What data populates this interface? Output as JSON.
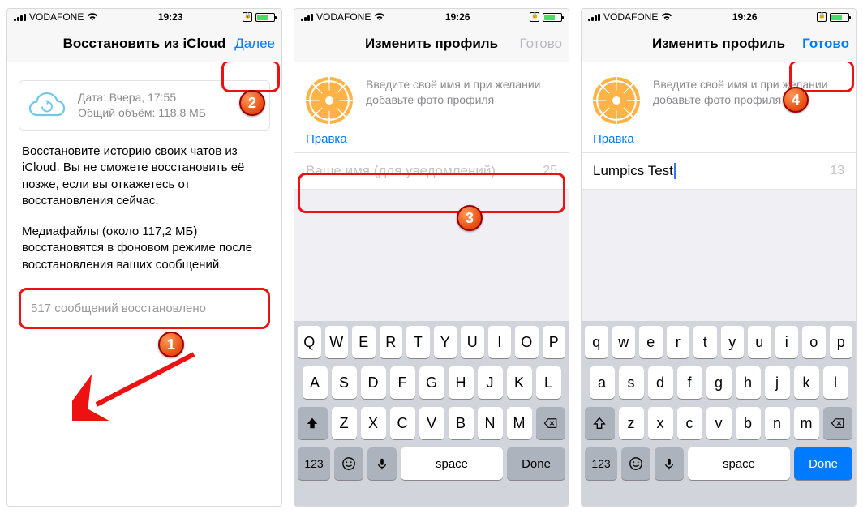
{
  "annotations": {
    "b1": "1",
    "b2": "2",
    "b3": "3",
    "b4": "4"
  },
  "screen1": {
    "carrier": "VODAFONE",
    "time": "19:23",
    "navTitle": "Восстановить из iCloud",
    "navAction": "Далее",
    "card": {
      "line1": "Дата: Вчера, 17:55",
      "line2": "Общий объём: 118,8 МБ"
    },
    "desc1": "Восстановите историю своих чатов из iCloud. Вы не сможете восстановить её позже, если вы откажетесь от восстановления сейчас.",
    "desc2": "Медиафайлы (около 117,2 МБ) восстановятся в фоновом режиме после восстановления ваших сообщений.",
    "status": "517 сообщений восстановлено"
  },
  "screen2": {
    "carrier": "VODAFONE",
    "time": "19:26",
    "navTitle": "Изменить профиль",
    "navAction": "Готово",
    "hint": "Введите своё имя и при желании добавьте фото профиля",
    "editLink": "Правка",
    "namePlaceholder": "Ваше имя (для уведомлений)",
    "counter": "25",
    "keyboard": {
      "row1": [
        "Q",
        "W",
        "E",
        "R",
        "T",
        "Y",
        "U",
        "I",
        "O",
        "P"
      ],
      "row2": [
        "A",
        "S",
        "D",
        "F",
        "G",
        "H",
        "J",
        "K",
        "L"
      ],
      "row3": [
        "Z",
        "X",
        "C",
        "V",
        "B",
        "N",
        "M"
      ],
      "n123": "123",
      "space": "space",
      "done": "Done"
    }
  },
  "screen3": {
    "carrier": "VODAFONE",
    "time": "19:26",
    "navTitle": "Изменить профиль",
    "navAction": "Готово",
    "hint": "Введите своё имя и при желании добавьте фото профиля",
    "editLink": "Правка",
    "nameValue": "Lumpics Test",
    "counter": "13",
    "keyboard": {
      "row1": [
        "q",
        "w",
        "e",
        "r",
        "t",
        "y",
        "u",
        "i",
        "o",
        "p"
      ],
      "row2": [
        "a",
        "s",
        "d",
        "f",
        "g",
        "h",
        "j",
        "k",
        "l"
      ],
      "row3": [
        "z",
        "x",
        "c",
        "v",
        "b",
        "n",
        "m"
      ],
      "n123": "123",
      "space": "space",
      "done": "Done"
    }
  }
}
